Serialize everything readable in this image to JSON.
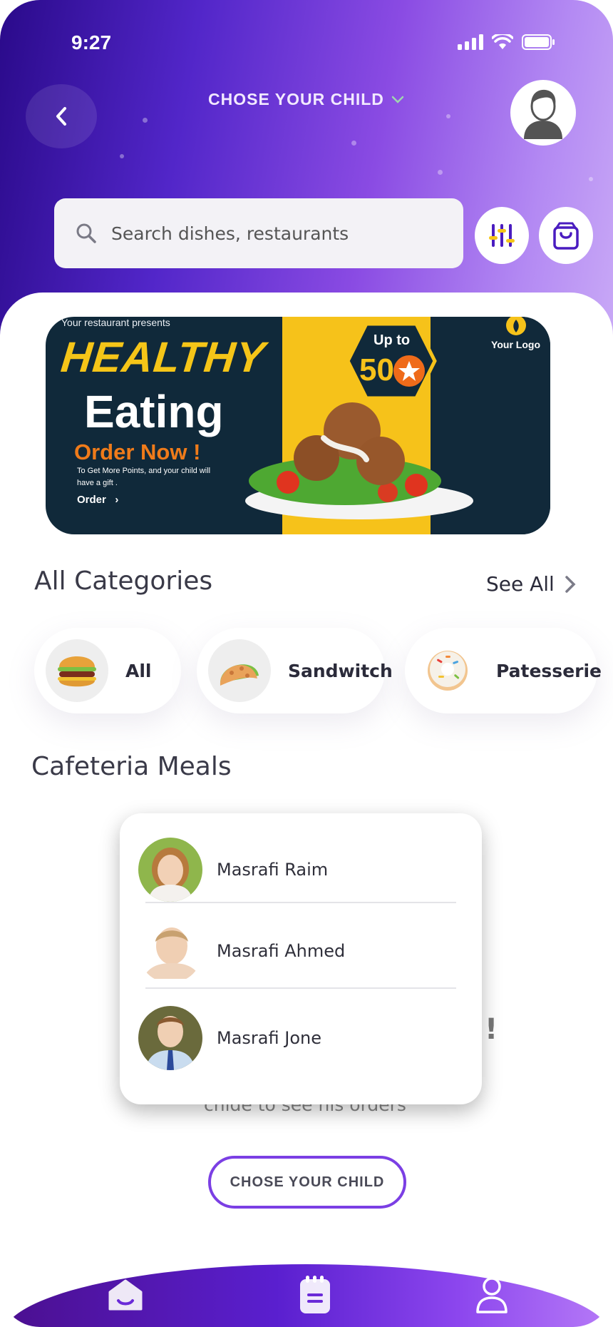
{
  "status_bar": {
    "time": "9:27"
  },
  "header": {
    "child_picker_label": "CHOSE YOUR CHILD",
    "back_icon": "chevron-left-icon",
    "profile_icon": "user-avatar-icon"
  },
  "search": {
    "placeholder": "Search dishes, restaurants"
  },
  "banner": {
    "presents": "Your restaurant presents",
    "headline": "HEALTHY",
    "subheadline": "Eating",
    "cta_title": "Order Now !",
    "cta_text": "To Get More Points, and your child will have a gift .",
    "order_label": "Order",
    "upto_label": "Up to",
    "upto_value": "50",
    "logo_text": "Your Logo"
  },
  "categories": {
    "title": "All Categories",
    "see_all": "See All",
    "items": [
      {
        "label": "All",
        "icon": "burger-icon"
      },
      {
        "label": "Sandwitch",
        "icon": "taco-icon"
      },
      {
        "label": "Patesserie",
        "icon": "donut-icon"
      }
    ]
  },
  "cafeteria": {
    "title": "Cafeteria Meals",
    "behind_text": "chide to see his orders",
    "behind_mark": "!"
  },
  "child_dropdown": {
    "children": [
      {
        "name": "Masrafi Raim"
      },
      {
        "name": "Masrafi Ahmed"
      },
      {
        "name": "Masrafi Jone"
      }
    ]
  },
  "chose_button": {
    "label": "CHOSE YOUR CHILD"
  },
  "bottom_nav": {
    "items": [
      {
        "icon": "home-icon"
      },
      {
        "icon": "orders-icon"
      },
      {
        "icon": "profile-icon"
      }
    ]
  },
  "colors": {
    "accent": "#7b3fe4",
    "header_start": "#2a0a8a",
    "header_end": "#c8a8f6",
    "filter_icon_yellow": "#f5c518"
  }
}
